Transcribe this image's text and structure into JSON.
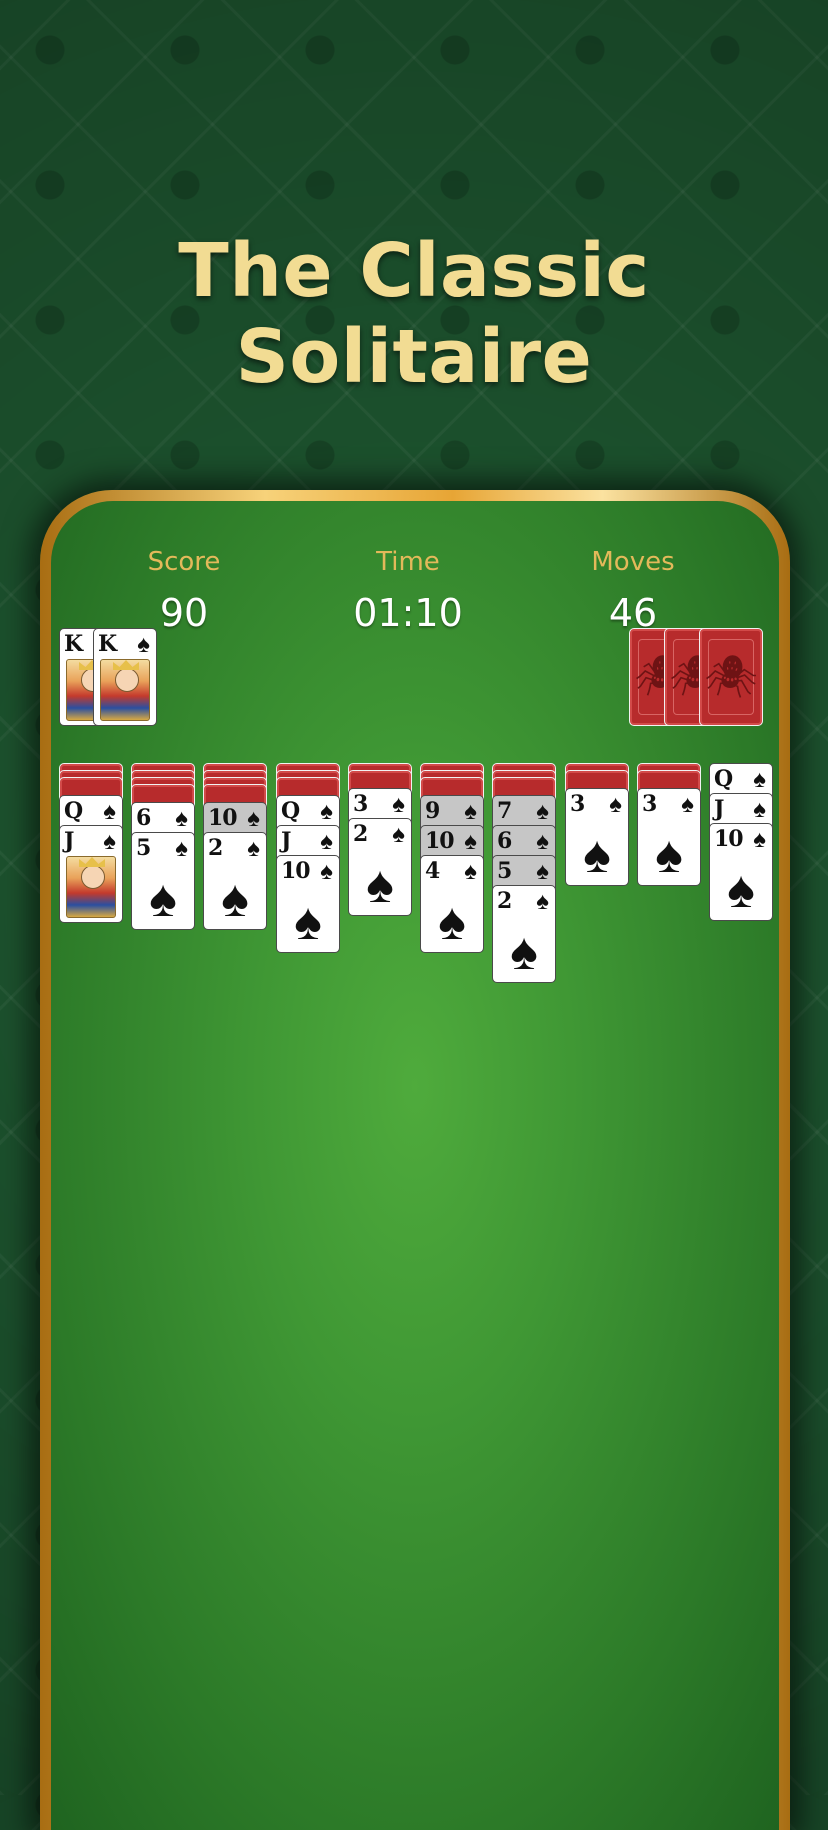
{
  "headline": "The Classic Solitaire",
  "stats": {
    "score_label": "Score",
    "score_value": "90",
    "time_label": "Time",
    "time_value": "01:10",
    "moves_label": "Moves",
    "moves_value": "46"
  },
  "suit_glyph": "♠",
  "spider_glyph": "🕷",
  "colors": {
    "title_gold": "#f2dc93",
    "felt_green": "#3f9734",
    "card_back_red": "#b72b2c",
    "label_gold": "#e3b95a"
  },
  "completed_sequences": [
    "K",
    "K"
  ],
  "stock_piles_remaining": 3,
  "tableau": [
    {
      "hidden": 3,
      "cards": [
        {
          "rank": "Q",
          "shaded": false
        },
        {
          "rank": "J",
          "shaded": false,
          "face": true
        }
      ]
    },
    {
      "hidden": 4,
      "cards": [
        {
          "rank": "6",
          "shaded": false
        },
        {
          "rank": "5",
          "shaded": false
        }
      ]
    },
    {
      "hidden": 4,
      "cards": [
        {
          "rank": "10",
          "shaded": true
        },
        {
          "rank": "2",
          "shaded": false
        }
      ]
    },
    {
      "hidden": 3,
      "cards": [
        {
          "rank": "Q",
          "shaded": false
        },
        {
          "rank": "J",
          "shaded": false
        },
        {
          "rank": "10",
          "shaded": false
        }
      ]
    },
    {
      "hidden": 2,
      "cards": [
        {
          "rank": "3",
          "shaded": false
        },
        {
          "rank": "2",
          "shaded": false
        }
      ]
    },
    {
      "hidden": 3,
      "cards": [
        {
          "rank": "9",
          "shaded": true
        },
        {
          "rank": "10",
          "shaded": true
        },
        {
          "rank": "4",
          "shaded": false
        }
      ]
    },
    {
      "hidden": 3,
      "cards": [
        {
          "rank": "7",
          "shaded": true
        },
        {
          "rank": "6",
          "shaded": true
        },
        {
          "rank": "5",
          "shaded": true
        },
        {
          "rank": "2",
          "shaded": false
        }
      ]
    },
    {
      "hidden": 2,
      "cards": [
        {
          "rank": "3",
          "shaded": false
        }
      ]
    },
    {
      "hidden": 2,
      "cards": [
        {
          "rank": "3",
          "shaded": false
        }
      ]
    },
    {
      "hidden": 0,
      "cards": [
        {
          "rank": "Q",
          "shaded": false
        },
        {
          "rank": "J",
          "shaded": false
        },
        {
          "rank": "10",
          "shaded": false
        }
      ]
    }
  ]
}
